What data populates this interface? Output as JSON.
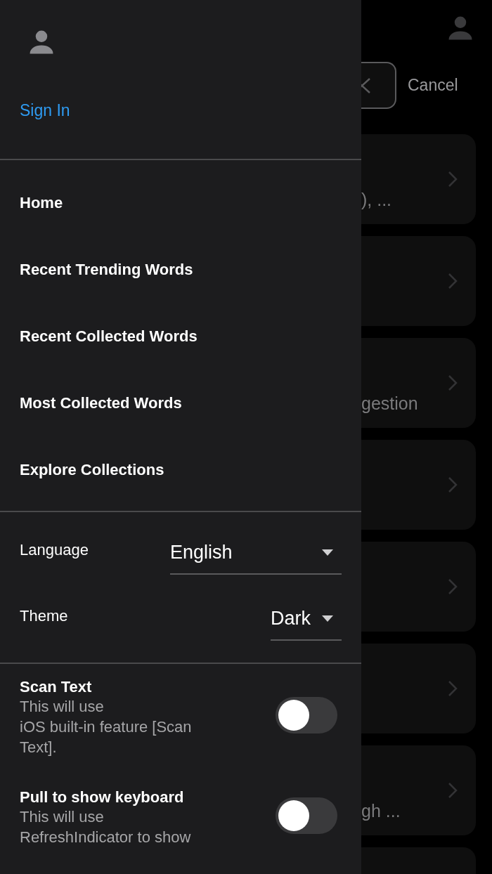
{
  "background": {
    "cancel": "Cancel",
    "results": [
      {
        "kind": "card",
        "text": "), ..."
      },
      {
        "kind": "card"
      },
      {
        "kind": "card",
        "text": "gestion"
      },
      {
        "kind": "card"
      },
      {
        "kind": "card"
      },
      {
        "kind": "card"
      },
      {
        "kind": "card",
        "text": "gh ..."
      },
      {
        "kind": "cut"
      }
    ]
  },
  "drawer": {
    "sign_in": "Sign In",
    "menu": [
      "Home",
      "Recent Trending Words",
      "Recent Collected Words",
      "Most Collected Words",
      "Explore Collections"
    ],
    "settings": [
      {
        "kind": "select",
        "label": "Language",
        "value": "English"
      },
      {
        "kind": "select",
        "label": "Theme",
        "value": "Dark"
      }
    ],
    "toggles": [
      {
        "title": "Scan Text",
        "description": "This will use\niOS built-in feature [Scan Text].",
        "on": false
      },
      {
        "title": "Pull to show keyboard",
        "description": "This will use\nRefreshIndicator to show",
        "on": false
      }
    ]
  }
}
